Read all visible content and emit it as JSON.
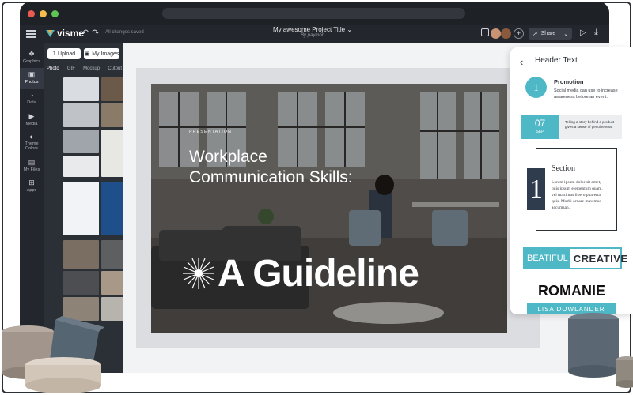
{
  "window": {
    "dot_colors": [
      "#e95a52",
      "#f4be4f",
      "#5fc554"
    ]
  },
  "toolbar": {
    "logo_text": "visme",
    "undo_icon": "↶",
    "redo_icon": "↷",
    "saved_status": "All changes saved",
    "project_title": "My awesome Project Title",
    "project_title_caret": "⌄",
    "byline": "By paymon",
    "add_collaborator": "+",
    "share_label": "Share",
    "share_caret": "⌄",
    "play_icon": "▷",
    "download_icon": "⤓"
  },
  "left_nav": {
    "items": [
      {
        "label": "Graphics",
        "icon": "❖"
      },
      {
        "label": "Photos",
        "icon": "▣"
      },
      {
        "label": "Data",
        "icon": "◔"
      },
      {
        "label": "Media",
        "icon": "▶"
      },
      {
        "label": "Theme Colors",
        "icon": "◐"
      },
      {
        "label": "My Files",
        "icon": "▤"
      },
      {
        "label": "Apps",
        "icon": "⊞"
      }
    ]
  },
  "assets_panel": {
    "upload_label": "Upload",
    "my_images_label": "My Images",
    "tabs": [
      "Photo",
      "GIF",
      "Mockup",
      "Cutout"
    ],
    "active_tab": "Photo"
  },
  "slide": {
    "kicker": "PRESENTATION",
    "headline": "Workplace Communication Skills:",
    "big_text": "A Guideline"
  },
  "side_panel": {
    "header": "Header Text",
    "promotion": {
      "number": "1",
      "title": "Promotion",
      "text": "Social media can use to increase awareness before an event."
    },
    "date_block": {
      "day": "07",
      "month": "SEP",
      "text": "Telling a story behind a product gives a sense of genuineness."
    },
    "section_block": {
      "number": "1",
      "title": "Section",
      "text": "Lorem ipsum dolor sit amet, quis ipsum elementum quam, vel maximus libero pharetra quis. Morbi ornare maximus accumsan."
    },
    "beat_left": "BEATIFUL",
    "beat_right": "CREATIVE",
    "romanie": "ROMANIE",
    "lisa": "LISA DOWLANDER"
  }
}
